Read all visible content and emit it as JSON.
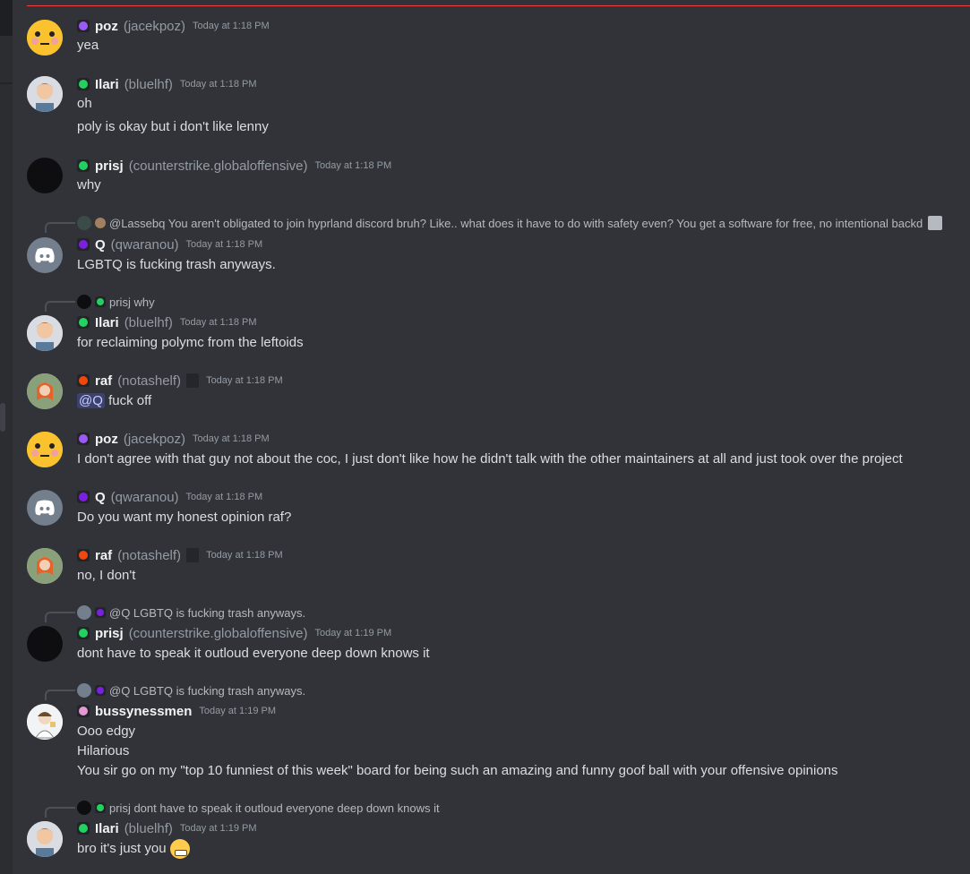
{
  "colors": {
    "background": "#313338",
    "divider": "#f23f43",
    "role_purple": "#9b59f6",
    "role_green": "#23a55a",
    "role_violet": "#7b1fe0",
    "role_orange": "#f0470d",
    "role_pink": "#e597d6"
  },
  "messages": [
    {
      "name": "poz",
      "handle": "(jacekpoz)",
      "time": "Today at 1:18 PM",
      "lines": [
        "yea"
      ]
    },
    {
      "name": "Ilari",
      "handle": "(bluelhf)",
      "time": "Today at 1:18 PM",
      "lines": [
        "oh",
        "poly is okay but i don't like lenny"
      ]
    },
    {
      "name": "prisj",
      "handle": "(counterstrike.globaloffensive)",
      "time": "Today at 1:18 PM",
      "lines": [
        "why"
      ]
    },
    {
      "reply": "@Lassebq You aren't obligated to join hyprland discord bruh? Like.. what does it have to do with safety even? You get a software for free, no intentional backd",
      "name": "Q",
      "handle": "(qwaranou)",
      "time": "Today at 1:18 PM",
      "lines": [
        "LGBTQ is fucking trash anyways."
      ]
    },
    {
      "reply": "prisj why",
      "name": "Ilari",
      "handle": "(bluelhf)",
      "time": "Today at 1:18 PM",
      "lines": [
        "for reclaiming polymc from the leftoids"
      ]
    },
    {
      "name": "raf",
      "handle": "(notashelf)",
      "time": "Today at 1:18 PM",
      "mention": "@Q",
      "lines": [
        "fuck off"
      ]
    },
    {
      "name": "poz",
      "handle": "(jacekpoz)",
      "time": "Today at 1:18 PM",
      "lines": [
        "I don't agree with that guy not about the coc, I just don't like how he didn't talk with the other maintainers at all and just took over the project"
      ]
    },
    {
      "name": "Q",
      "handle": "(qwaranou)",
      "time": "Today at 1:18 PM",
      "lines": [
        "Do you want my honest opinion raf?"
      ]
    },
    {
      "name": "raf",
      "handle": "(notashelf)",
      "time": "Today at 1:18 PM",
      "lines": [
        "no, I don't"
      ]
    },
    {
      "reply": "@Q LGBTQ is fucking trash anyways.",
      "name": "prisj",
      "handle": "(counterstrike.globaloffensive)",
      "time": "Today at 1:19 PM",
      "lines": [
        "dont have to speak it outloud everyone deep down knows it"
      ]
    },
    {
      "reply": "@Q LGBTQ is fucking trash anyways.",
      "name": "bussynessmen",
      "time": "Today at 1:19 PM",
      "lines": [
        "Ooo edgy",
        "Hilarious",
        "You sir go on my \"top 10 funniest of this week\" board for being such an amazing and funny goof ball with your offensive opinions"
      ]
    },
    {
      "reply": "prisj dont have to speak it outloud everyone deep down knows it",
      "name": "Ilari",
      "handle": "(bluelhf)",
      "time": "Today at 1:19 PM",
      "lines": [
        "bro it's just you"
      ],
      "emoji": "grimacing-face"
    }
  ]
}
